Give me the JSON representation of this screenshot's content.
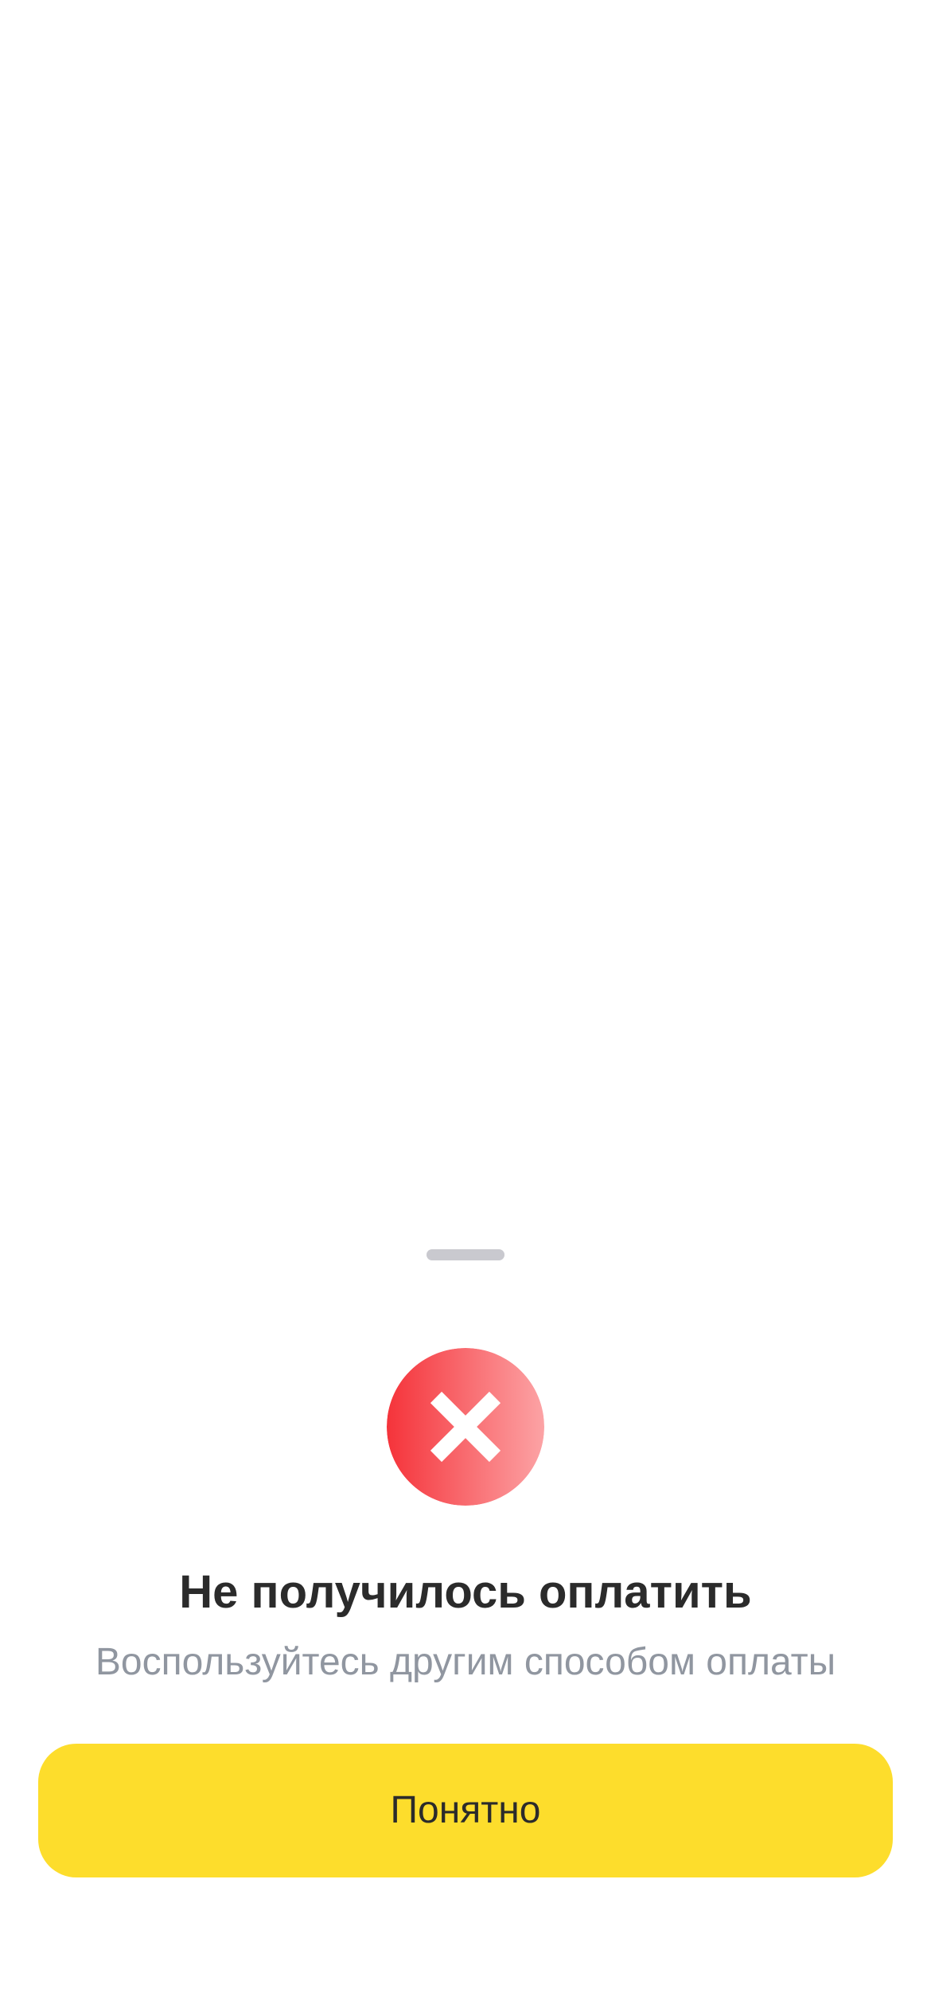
{
  "sheet": {
    "title": "Не получилось оплатить",
    "subtitle": "Воспользуйтесь другим способом оплаты",
    "button_label": "Понятно",
    "icon": "error-cross-icon"
  },
  "colors": {
    "background": "#ffffff",
    "grabber": "#c9c9cf",
    "icon_gradient_start": "#f5333a",
    "icon_gradient_end": "#fca3a5",
    "title": "#2b2b2b",
    "subtitle": "#9096a0",
    "button_background": "#fddd2c",
    "button_text": "#2b2b2b"
  }
}
